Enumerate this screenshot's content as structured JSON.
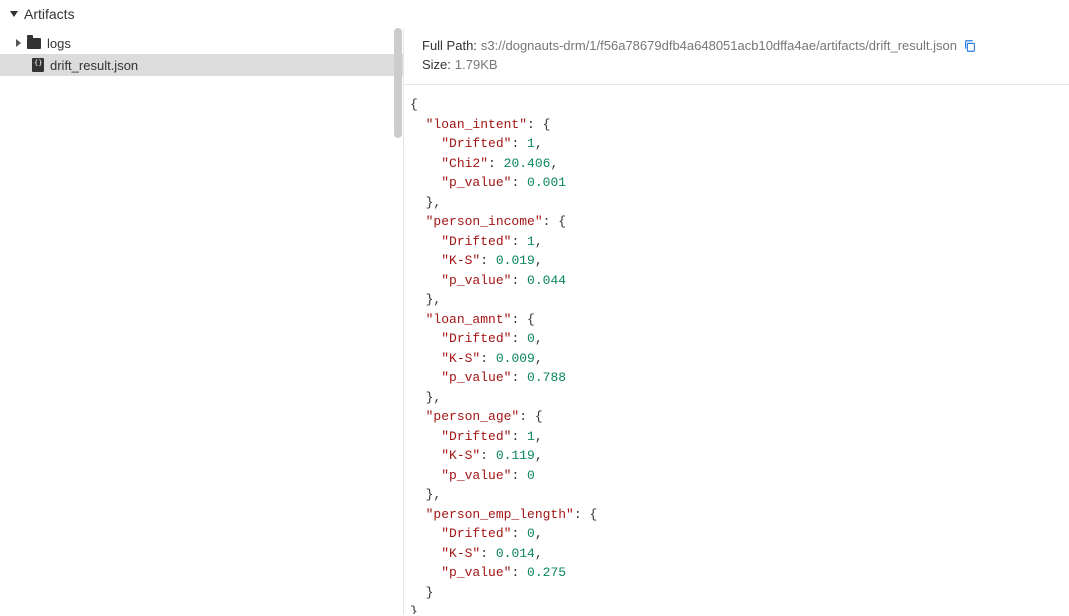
{
  "header": {
    "title": "Artifacts"
  },
  "sidebar": {
    "folder_label": "logs",
    "file_label": "drift_result.json"
  },
  "details": {
    "full_path_label": "Full Path:",
    "full_path_value": "s3://dognauts-drm/1/f56a78679dfb4a648051acb10dffa4ae/artifacts/drift_result.json",
    "size_label": "Size:",
    "size_value": "1.79KB"
  },
  "json_data": {
    "loan_intent": {
      "Drifted": 1,
      "Chi2": 20.406,
      "p_value": 0.001
    },
    "person_income": {
      "Drifted": 1,
      "K-S": 0.019,
      "p_value": 0.044
    },
    "loan_amnt": {
      "Drifted": 0,
      "K-S": 0.009,
      "p_value": 0.788
    },
    "person_age": {
      "Drifted": 1,
      "K-S": 0.119,
      "p_value": 0
    },
    "person_emp_length": {
      "Drifted": 0,
      "K-S": 0.014,
      "p_value": 0.275
    }
  }
}
